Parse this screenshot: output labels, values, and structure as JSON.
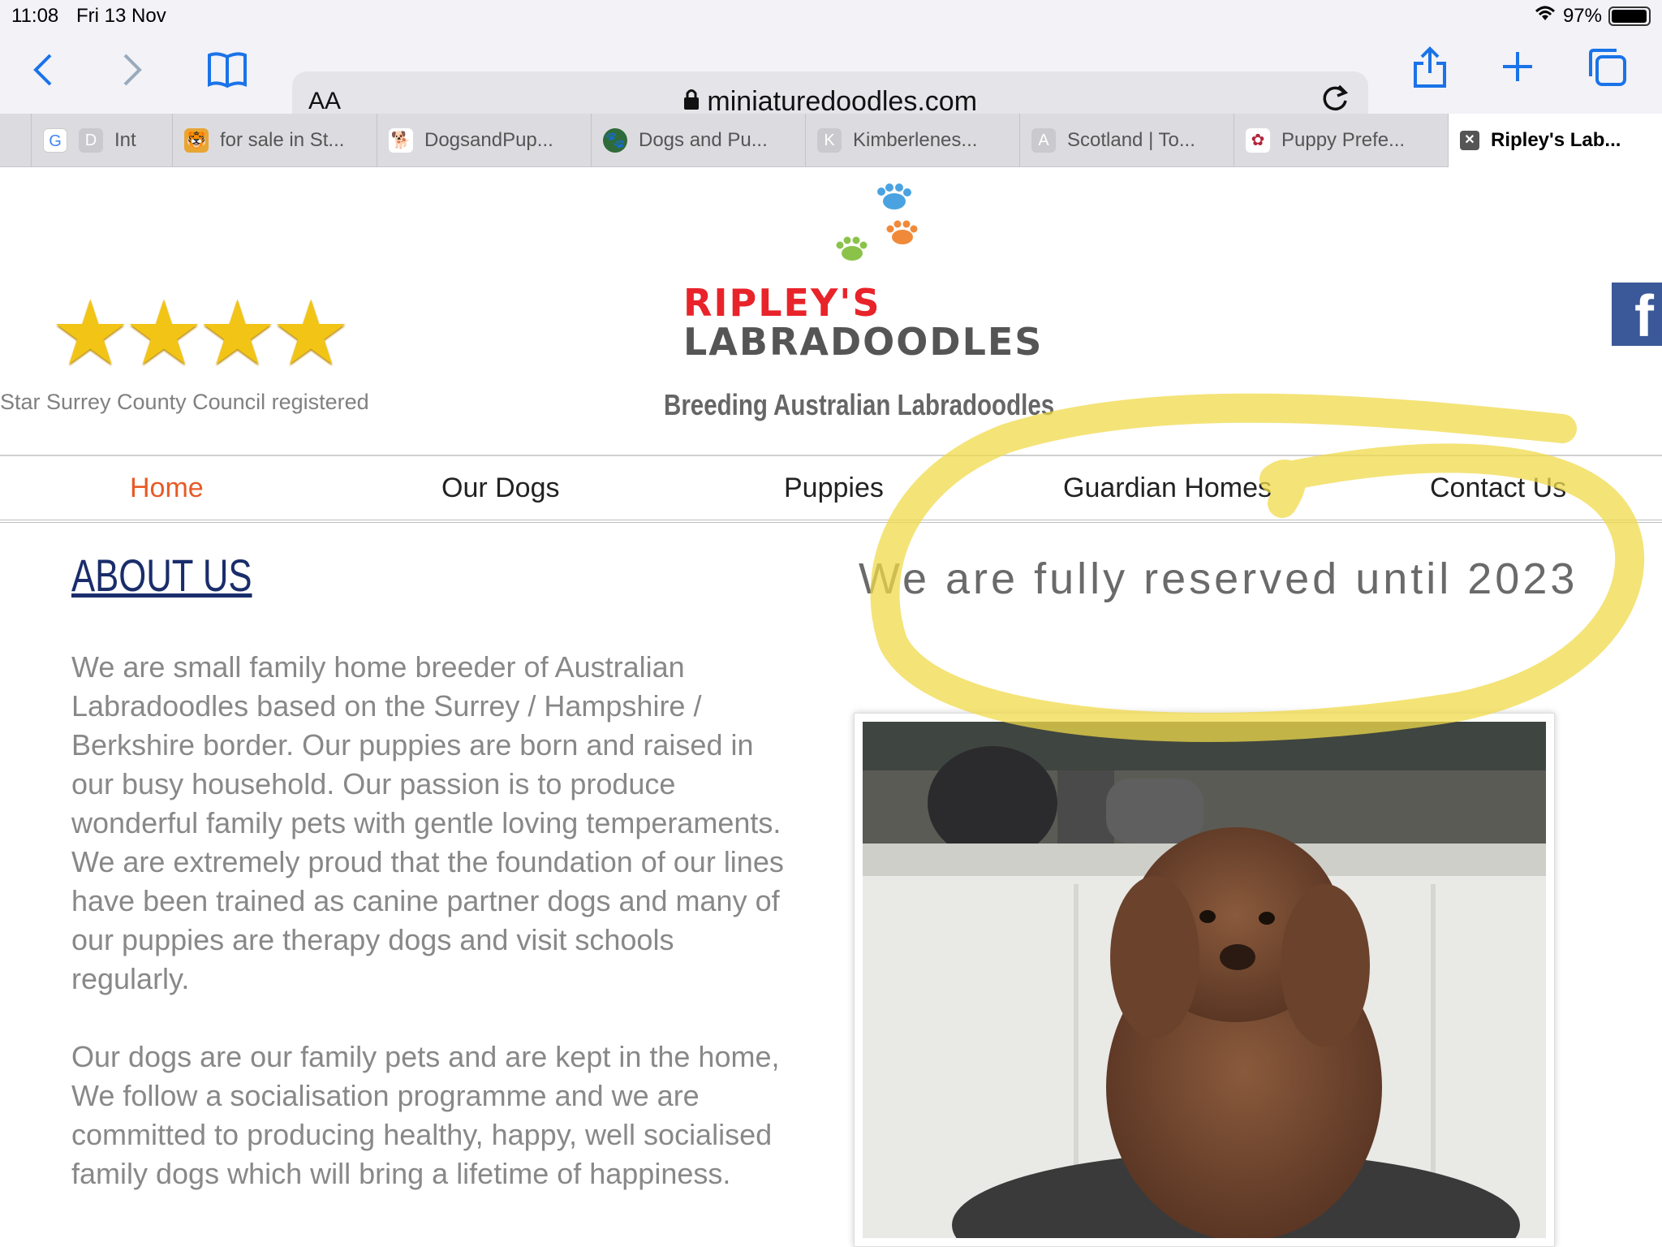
{
  "status": {
    "time": "11:08",
    "date": "Fri 13 Nov",
    "battery": "97%",
    "battery_level": 0.97
  },
  "toolbar": {
    "text_size_label": "AA",
    "url": "miniaturedoodles.com"
  },
  "tabs": [
    {
      "fav": "D",
      "label": "Int"
    },
    {
      "fav": "🐯",
      "label": "for sale in St..."
    },
    {
      "fav": "🐕",
      "label": "DogsandPup..."
    },
    {
      "fav": "🐾",
      "label": "Dogs and Pu..."
    },
    {
      "fav": "K",
      "label": "Kimberlenes..."
    },
    {
      "fav": "A",
      "label": "Scotland | To..."
    },
    {
      "fav": "✿",
      "label": "Puppy Prefe..."
    },
    {
      "fav": "✕",
      "label": "Ripley's Lab..."
    }
  ],
  "site": {
    "rating_stars": "★★★★",
    "council": "Star Surrey County Council registered",
    "logo_line1": "RIPLEY'S",
    "logo_line2": "LABRADOODLES",
    "tagline": "Breeding Australian Labradoodles",
    "fb_letter": "f",
    "nav": [
      "Home",
      "Our Dogs",
      "Puppies",
      "Guardian Homes",
      "Contact Us"
    ],
    "about_title": "ABOUT US",
    "reserved": "We are fully reserved until 2023",
    "para1": "We are small family home breeder of Australian Labradoodles based on the Surrey / Hampshire / Berkshire border.  Our puppies are born and raised in our busy household.  Our passion is to produce wonderful family pets with gentle loving temperaments.  We are extremely proud that the foundation of our lines have been trained as canine partner dogs and many of our puppies are therapy dogs and visit schools regularly.",
    "para2": "Our dogs are our family pets and are kept in the home, We follow a socialisation programme and we are committed to producing healthy, happy, well socialised family dogs which will bring a lifetime of happiness."
  },
  "colors": {
    "accent": "#1a73e8",
    "nav_active": "#e85a25",
    "logo_red": "#e8232a",
    "highlight": "#f0d94a"
  }
}
